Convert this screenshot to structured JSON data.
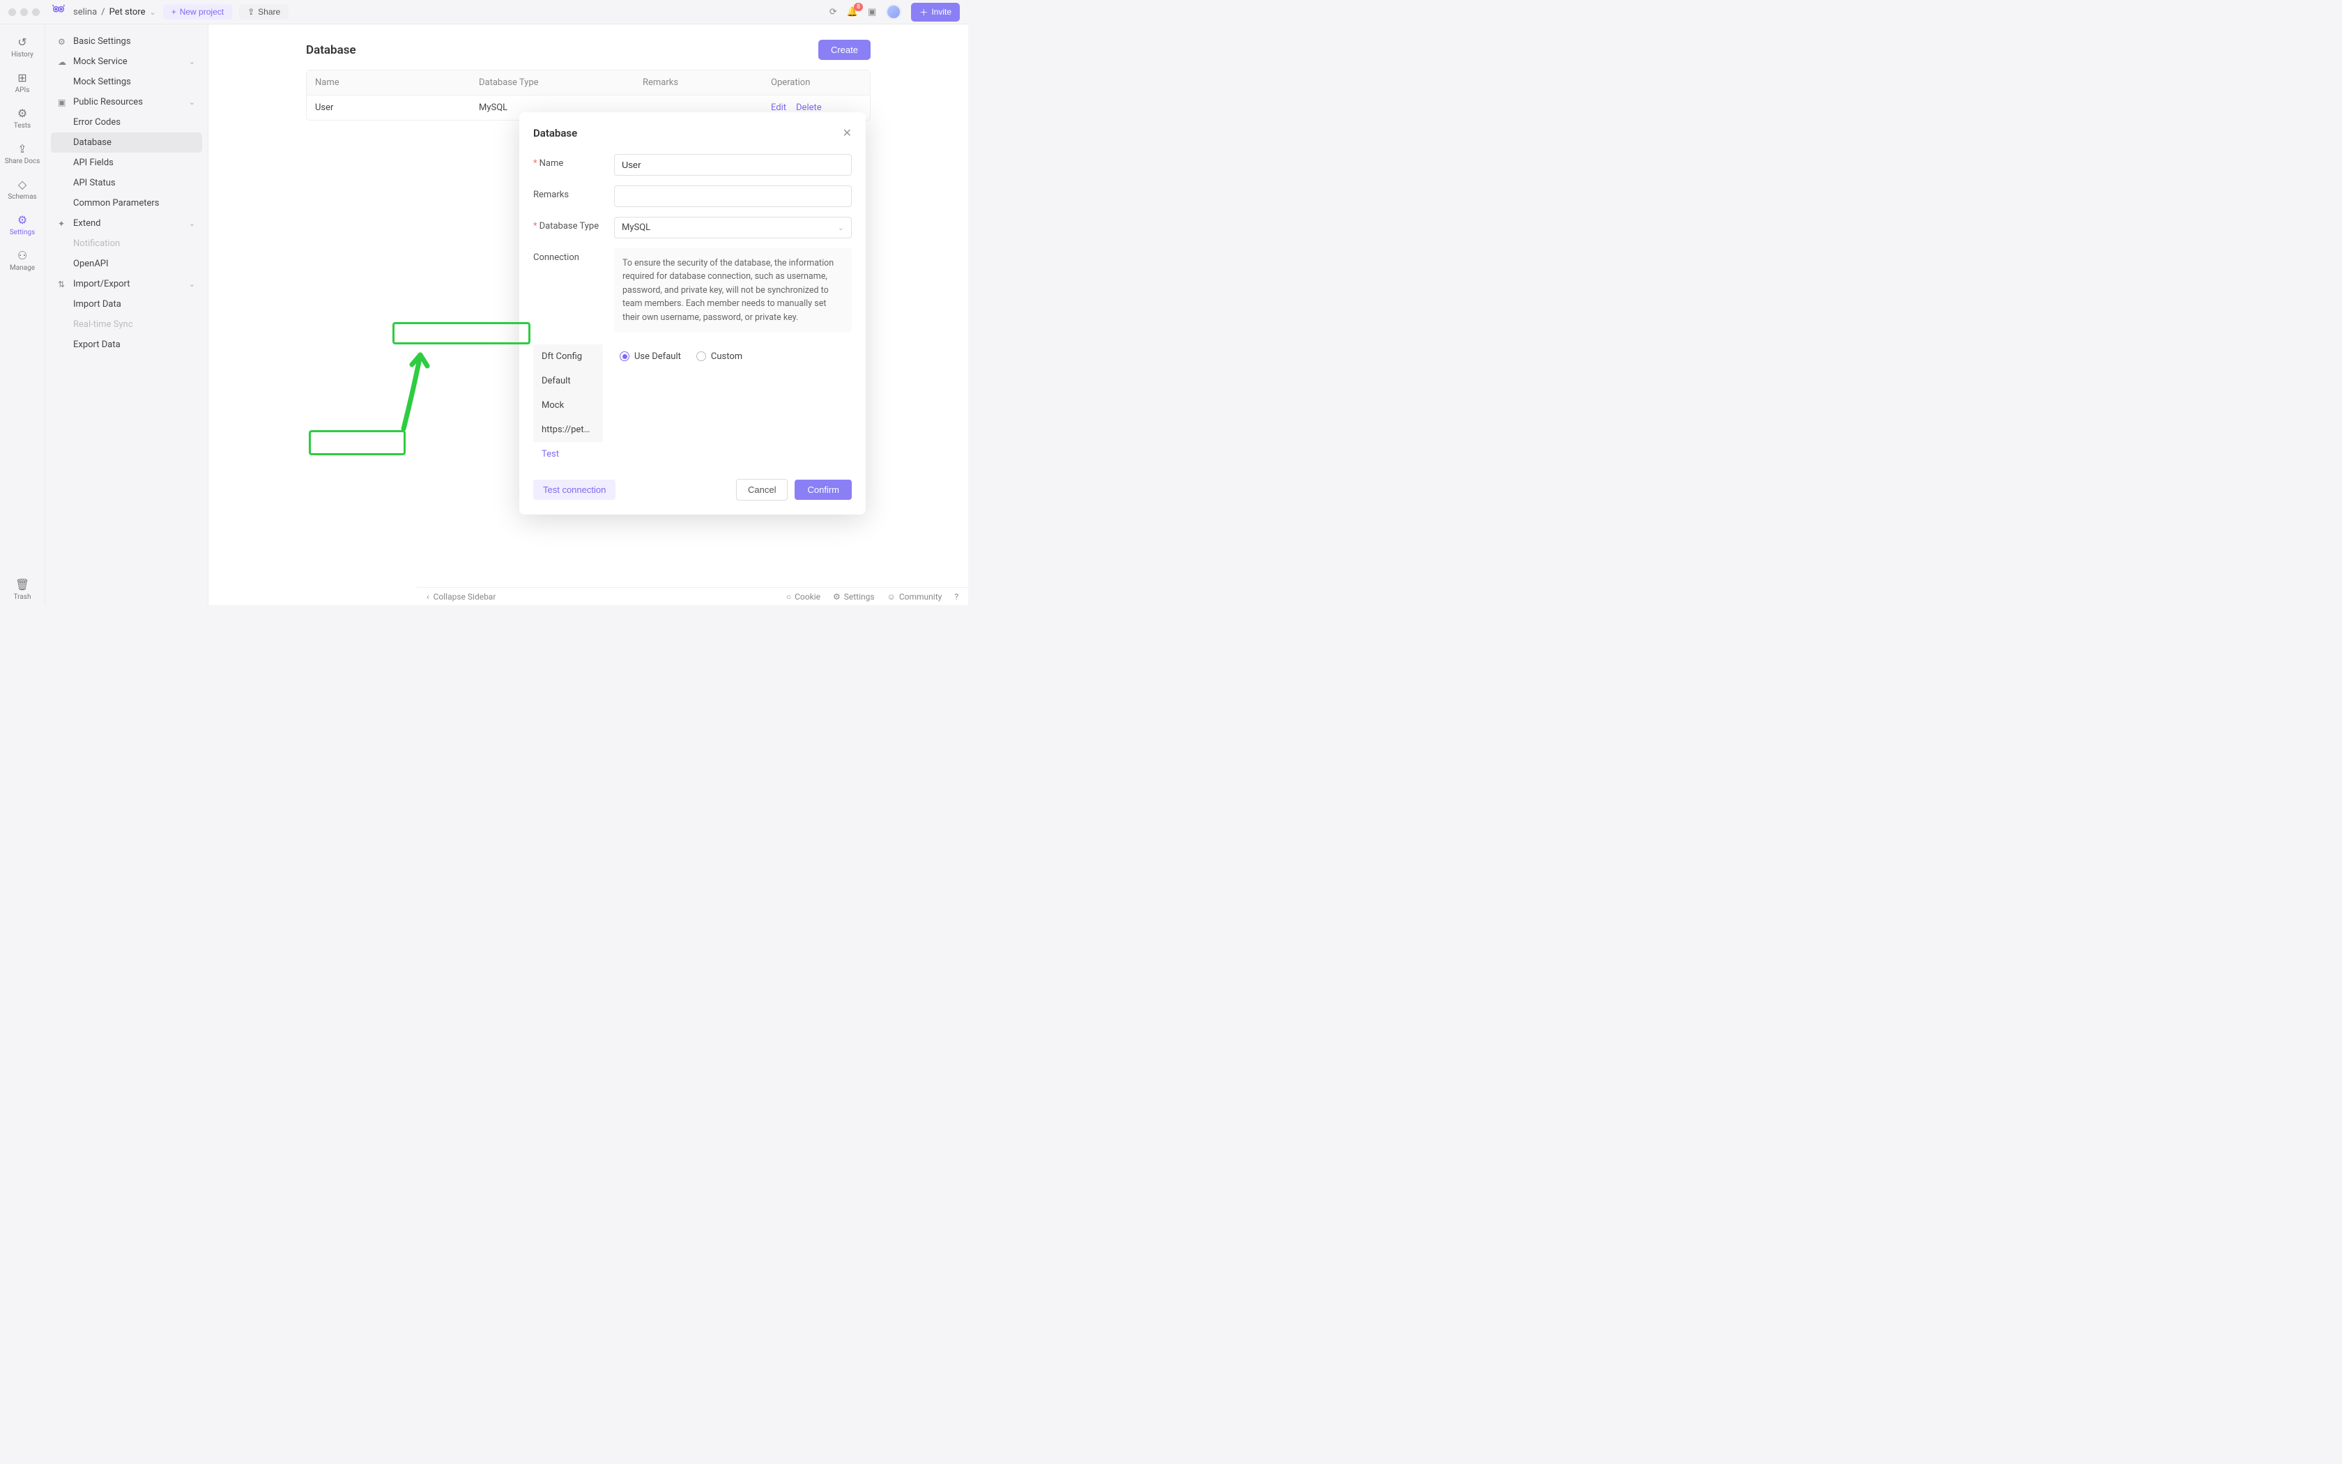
{
  "topbar": {
    "account_label": "selina",
    "separator": "/",
    "project_label": "Pet store",
    "new_project_label": "New project",
    "share_label": "Share",
    "notification_badge": "8",
    "invite_label": "Invite"
  },
  "rail": {
    "items": [
      {
        "icon": "history-icon",
        "label": "History"
      },
      {
        "icon": "apis-icon",
        "label": "APIs"
      },
      {
        "icon": "tests-icon",
        "label": "Tests"
      },
      {
        "icon": "sharedocs-icon",
        "label": "Share Docs"
      },
      {
        "icon": "schemas-icon",
        "label": "Schemas"
      },
      {
        "icon": "settings-icon",
        "label": "Settings"
      },
      {
        "icon": "manage-icon",
        "label": "Manage"
      }
    ],
    "trash_label": "Trash"
  },
  "sidebar": {
    "groups": [
      {
        "icon": "settings",
        "label": "Basic Settings",
        "children": []
      },
      {
        "icon": "mock",
        "label": "Mock Service",
        "expandable": true,
        "children": [
          {
            "label": "Mock Settings"
          }
        ]
      },
      {
        "icon": "public",
        "label": "Public Resources",
        "expandable": true,
        "children": [
          {
            "label": "Error Codes"
          },
          {
            "label": "Database",
            "active": true
          },
          {
            "label": "API Fields"
          },
          {
            "label": "API Status"
          },
          {
            "label": "Common Parameters"
          }
        ]
      },
      {
        "icon": "extend",
        "label": "Extend",
        "expandable": true,
        "children": [
          {
            "label": "Notification",
            "disabled": true
          },
          {
            "label": "OpenAPI"
          }
        ]
      },
      {
        "icon": "import",
        "label": "Import/Export",
        "expandable": true,
        "children": [
          {
            "label": "Import Data"
          },
          {
            "label": "Real-time Sync",
            "disabled": true
          },
          {
            "label": "Export Data"
          }
        ]
      }
    ]
  },
  "page": {
    "title": "Database",
    "create_label": "Create",
    "columns": {
      "name": "Name",
      "type": "Database Type",
      "remarks": "Remarks",
      "op": "Operation"
    },
    "rows": [
      {
        "name": "User",
        "type": "MySQL",
        "remarks": "",
        "edit_label": "Edit",
        "delete_label": "Delete"
      }
    ]
  },
  "modal": {
    "title": "Database",
    "labels": {
      "name": "Name",
      "remarks": "Remarks",
      "dbtype": "Database Type",
      "connection": "Connection"
    },
    "values": {
      "name": "User",
      "remarks": "",
      "dbtype": "MySQL"
    },
    "connection_notice": "To ensure the security of the database, the information required for database connection, such as username, password, and private key, will not be synchronized to team members. Each member needs to manually set their own username, password, or private key.",
    "conn_tabs": [
      "Dft Config",
      "Default",
      "Mock",
      "https://pet…",
      "Test"
    ],
    "conn_tab_active": "Test",
    "radios": {
      "use_default": "Use Default",
      "custom": "Custom",
      "selected": "use_default"
    },
    "buttons": {
      "test": "Test connection",
      "cancel": "Cancel",
      "confirm": "Confirm"
    }
  },
  "footer": {
    "collapse": "Collapse Sidebar",
    "cookie": "Cookie",
    "settings": "Settings",
    "community": "Community"
  }
}
